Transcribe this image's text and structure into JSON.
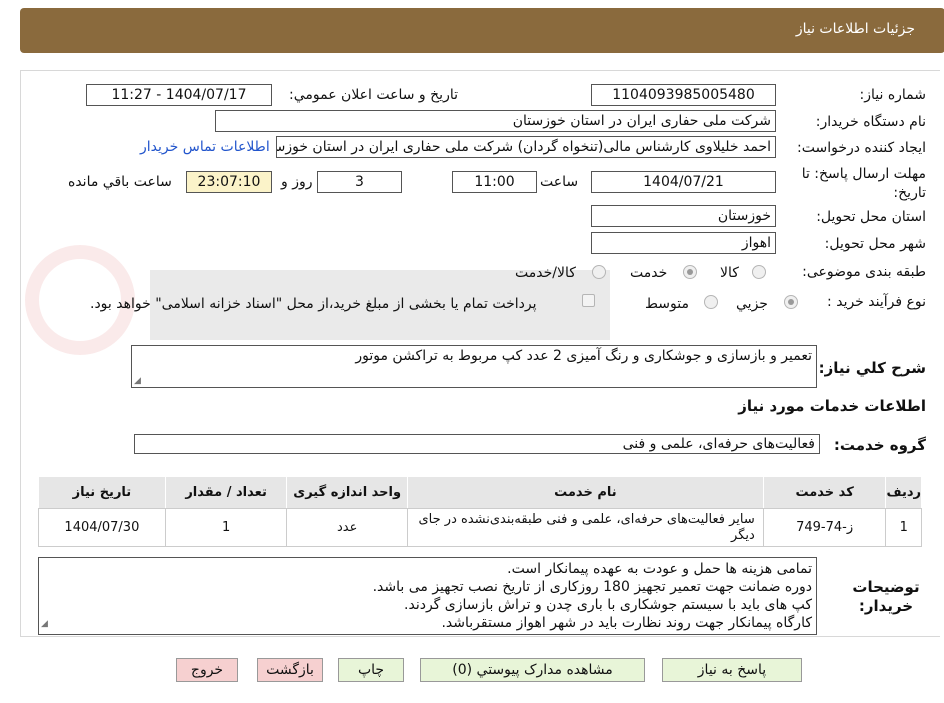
{
  "header": {
    "title": "جزئيات اطلاعات نياز"
  },
  "fields": {
    "need_number_label": "شماره نياز:",
    "need_number": "1104093985005480",
    "announce_label": "تاريخ و ساعت اعلان عمومي:",
    "announce_value": "1404/07/17 - 11:27",
    "buyer_label": "نام دستگاه خريدار:",
    "buyer_value": "شرکت ملی حفاری ایران در استان خوزستان",
    "creator_label": "ايجاد کننده درخواست:",
    "creator_value": "احمد خلیلاوی کارشناس مالی(تنخواه گردان) شرکت ملی حفاری ایران در استان خوزستان",
    "contact_link": "اطلاعات تماس خريدار",
    "deadline_label": "مهلت ارسال پاسخ: تا تاريخ:",
    "deadline_date": "1404/07/21",
    "time_label": "ساعت",
    "deadline_time": "11:00",
    "days_value": "3",
    "days_label": "روز و",
    "remaining_value": "23:07:10",
    "remaining_label": "ساعت باقي مانده",
    "province_label": "استان محل تحويل:",
    "province_value": "خوزستان",
    "city_label": "شهر محل تحويل:",
    "city_value": "اهواز",
    "category_label": "طبقه بندی موضوعی:",
    "category_options": [
      "کالا",
      "خدمت",
      "کالا/خدمت"
    ],
    "category_selected": "خدمت",
    "process_label": "نوع فرآيند خريد :",
    "process_options": [
      "جزيي",
      "متوسط"
    ],
    "process_selected": "جزيي",
    "payment_note": "پرداخت تمام يا بخشی از مبلغ خريد،از محل \"اسناد خزانه اسلامی\" خواهد بود."
  },
  "description": {
    "label": "شرح کلي نياز:",
    "value": "تعمیر و بازسازی و جوشکاری و رنگ آمیزی 2 عدد کپ مربوط به تراکشن موتور"
  },
  "services": {
    "section_title": "اطلاعات خدمات مورد نياز",
    "group_label": "گروه خدمت:",
    "group_value": "فعاليت‌های حرفه‌ای، علمی و فنی",
    "columns": [
      "رديف",
      "کد خدمت",
      "نام خدمت",
      "واحد اندازه گيری",
      "تعداد / مقدار",
      "تاريخ نياز"
    ],
    "rows": [
      [
        "1",
        "ز-74-749",
        "ساير فعاليت‌های حرفه‌ای، علمی و فنی طبقه‌بندی‌نشده در جای ديگر",
        "عدد",
        "1",
        "1404/07/30"
      ]
    ]
  },
  "buyer_notes": {
    "label": "توضيحات خريدار:",
    "lines": [
      "تمامی هزینه ها حمل و عودت به عهده پیمانکار است.",
      "دوره ضمانت جهت تعمیر تجهیز 180 روزکاری از تاریخ نصب تجهیز می باشد.",
      "کپ های باید با سیستم جوشکاری با باری چدن و تراش بازسازی گردند.",
      "کارگاه پیمانکار جهت روند نظارت باید در شهر اهواز مستقرباشد."
    ]
  },
  "buttons": {
    "reply": "پاسخ به نياز",
    "attachments": "مشاهده مدارک پيوستي (0)",
    "print": "چاپ",
    "back": "بازگشت",
    "exit": "خروج"
  },
  "colors": {
    "title_bar": "#8a6a3d",
    "button_green": "#e8f5d8",
    "button_pink": "#f6d0d0",
    "highlight": "#fbf3c9"
  }
}
